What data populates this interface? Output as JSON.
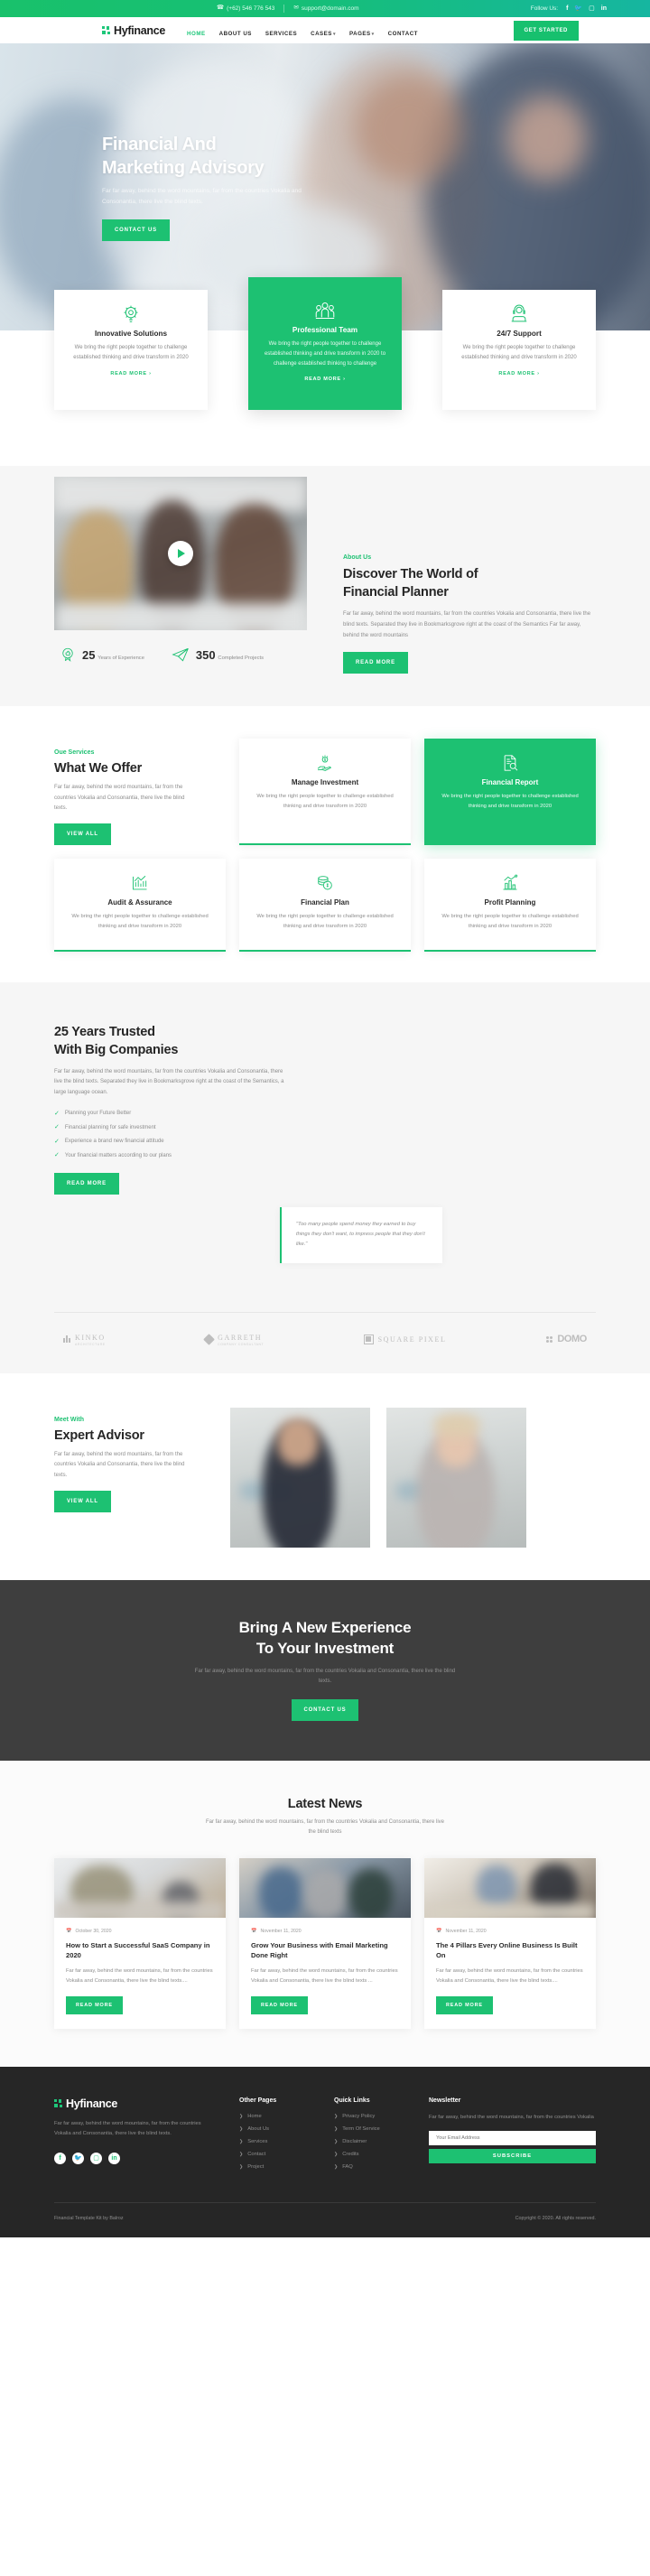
{
  "topbar": {
    "phone": "(+62) 546 776 543",
    "email": "support@domain.com",
    "follow_label": "Follow Us:",
    "socials": [
      "facebook-icon",
      "twitter-icon",
      "instagram-icon",
      "linkedin-icon"
    ]
  },
  "nav": {
    "brand": "Hyfinance",
    "links": [
      {
        "label": "HOME",
        "active": true,
        "caret": false
      },
      {
        "label": "ABOUT US",
        "active": false,
        "caret": false
      },
      {
        "label": "SERVICES",
        "active": false,
        "caret": false
      },
      {
        "label": "CASES",
        "active": false,
        "caret": true
      },
      {
        "label": "PAGES",
        "active": false,
        "caret": true
      },
      {
        "label": "CONTACT",
        "active": false,
        "caret": false
      }
    ],
    "cta": "GET STARTED"
  },
  "hero": {
    "title_line1": "Financial And",
    "title_line2": "Marketing Advisory",
    "paragraph": "Far far away, behind the word mountains, far from the countries Vokalia and Consonantia, there live the blind texts.",
    "button": "CONTACT US"
  },
  "features": [
    {
      "icon": "gear-lightbulb-icon",
      "title": "Innovative Solutions",
      "text": "We bring the right people together to challenge established thinking and drive transform in 2020",
      "link": "READ MORE",
      "highlight": false
    },
    {
      "icon": "people-group-icon",
      "title": "Professional Team",
      "text": "We bring the right people together to challenge established thinking and drive transform in 2020 to challenge established thinking to challenge",
      "link": "READ MORE",
      "highlight": true
    },
    {
      "icon": "support-headset-icon",
      "title": "24/7 Support",
      "text": "We bring the right people together to challenge established thinking and drive transform in 2020",
      "link": "READ MORE",
      "highlight": false
    }
  ],
  "about": {
    "eyebrow": "About Us",
    "title_line1": "Discover The World of",
    "title_line2": "Financial Planner",
    "paragraph": "Far far away, behind the word mountains, far from the countries Vokalia and Consonantia, there live the blind texts. Separated they live in Bookmarksgrove right at the coast of the Semantics Far far away, behind the word mountains",
    "button": "READ MORE",
    "stats": [
      {
        "icon": "badge-thumbsup-icon",
        "number": "25",
        "label": "Years of Experience"
      },
      {
        "icon": "paper-plane-icon",
        "number": "350",
        "label": "Completed Projects"
      }
    ]
  },
  "services": {
    "eyebrow": "Oue Services",
    "title": "What We Offer",
    "paragraph": "Far far away, behind the word mountains, far from the countries Vokalia and Consonantia, there live the blind texts.",
    "button": "VIEW ALL",
    "cards": [
      {
        "icon": "hand-money-icon",
        "title": "Manage Investment",
        "text": "We bring the right people together to challenge established thinking and drive transform in 2020",
        "highlight": false
      },
      {
        "icon": "report-search-icon",
        "title": "Financial Report",
        "text": "We bring the right people together to challenge established thinking and drive transform in 2020",
        "highlight": true
      },
      {
        "icon": "bar-chart-icon",
        "title": "Audit & Assurance",
        "text": "We bring the right people together to challenge established thinking and drive transform in 2020",
        "highlight": false
      },
      {
        "icon": "coin-stack-icon",
        "title": "Financial Plan",
        "text": "We bring the right people together to challenge established thinking and drive transform in 2020",
        "highlight": false
      },
      {
        "icon": "growth-chart-icon",
        "title": "Profit Planning",
        "text": "We bring the right people together to challenge established thinking and drive transform in 2020",
        "highlight": false
      }
    ]
  },
  "trusted": {
    "title_line1": "25 Years Trusted",
    "title_line2": "With Big Companies",
    "paragraph": "Far far away, behind the word mountains, far from the countries Vokalia and Consonantia, there live the blind texts. Separated they live in Bookmarksgrove right at the coast of the Semantics, a large language ocean.",
    "checklist": [
      "Planning your Future Better",
      "Financial planning for safe investment",
      "Experience a brand new financial attitude",
      "Your financial matters according to our plans"
    ],
    "button": "READ MORE",
    "quote": "\"Too many people spend money they earned to buy things they don't want, to impress people that they don't like.\"",
    "logos": [
      {
        "name": "KINKO",
        "sub": "ARCHITECTURE",
        "icon": "bars-icon"
      },
      {
        "name": "GARRETH",
        "sub": "COMPANY CONSULTANT",
        "icon": "diamond-icon"
      },
      {
        "name": "SQUARE PIXEL",
        "sub": "",
        "icon": "square-icon"
      },
      {
        "name": "DOMO",
        "sub": "",
        "icon": "dots-icon"
      }
    ]
  },
  "team": {
    "eyebrow": "Meet With",
    "title": "Expert Advisor",
    "paragraph": "Far far away, behind the word mountains, far from the countries Vokalia and Consonantia, there live the blind texts.",
    "button": "VIEW ALL",
    "photos": [
      "advisor-photo-male",
      "advisor-photo-female"
    ]
  },
  "cta": {
    "title_line1": "Bring A New Experience",
    "title_line2": "To Your Investment",
    "paragraph": "Far far away, behind the word mountains, far from the countries Vokalia and Consonantia, there live the blind texts.",
    "button": "CONTACT US"
  },
  "news": {
    "title": "Latest News",
    "subtitle": "Far far away, behind the word mountains, far from the countries Vokalia and Consonantia, there live the blind texts",
    "posts": [
      {
        "date": "October 30, 2020",
        "title": "How to Start a Successful SaaS Company in 2020",
        "excerpt": "Far far away, behind the word mountains, far from the countries Vokalia and Consonantia, there live the blind texts....",
        "button": "READ MORE"
      },
      {
        "date": "November 11, 2020",
        "title": "Grow Your Business with Email Marketing Done Right",
        "excerpt": "Far far away, behind the word mountains, far from the countries Vokalia and Consonantia, there live the blind texts ...",
        "button": "READ MORE"
      },
      {
        "date": "November 11, 2020",
        "title": "The 4 Pillars Every Online Business Is Built On",
        "excerpt": "Far far away, behind the word mountains, far from the countries Vokalia and Consonantia, there live the blind texts....",
        "button": "READ MORE"
      }
    ]
  },
  "footer": {
    "brand": "Hyfinance",
    "about": "Far far away, behind the word mountains, far from the countries Vokalia and Consonantia, there live the blind texts.",
    "socials": [
      "facebook-icon",
      "twitter-icon",
      "instagram-icon",
      "linkedin-icon"
    ],
    "other_pages": {
      "title": "Other Pages",
      "items": [
        "Home",
        "About Us",
        "Services",
        "Contact",
        "Project"
      ]
    },
    "quick_links": {
      "title": "Quick Links",
      "items": [
        "Privacy Policy",
        "Term Of Service",
        "Disclaimer",
        "Credits",
        "FAQ"
      ]
    },
    "newsletter": {
      "title": "Newsletter",
      "text": "Far far away, behind the word mountains, far from the countries Vokalia",
      "placeholder": "Your Email Address",
      "button": "SUBSCRIBE"
    },
    "credit": "Financial Template Kit by Balroz",
    "copyright": "Copyright © 2020. All rights reserved."
  },
  "colors": {
    "brand_green": "#1dc172",
    "dark": "#262626",
    "cta_bg": "#3e3e3e"
  }
}
